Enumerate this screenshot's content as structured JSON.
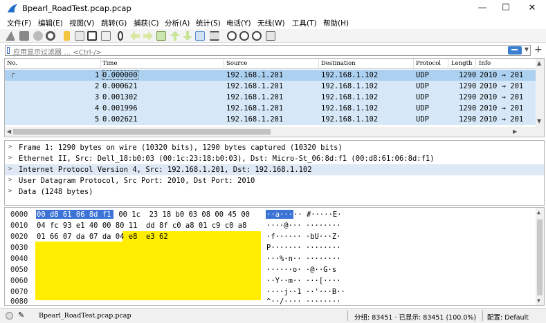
{
  "window": {
    "title": "Bpearl_RoadTest.pcap.pcap"
  },
  "menu": [
    "文件(F)",
    "编辑(E)",
    "视图(V)",
    "跳转(G)",
    "捕获(C)",
    "分析(A)",
    "统计(S)",
    "电话(Y)",
    "无线(W)",
    "工具(T)",
    "帮助(H)"
  ],
  "filter": {
    "placeholder": "应用显示过滤器 … <Ctrl-/>"
  },
  "packet_list": {
    "columns": [
      "No.",
      "Time",
      "Source",
      "Destination",
      "Protocol",
      "Length",
      "Info"
    ],
    "rows": [
      {
        "no": "1",
        "time": "0.000000",
        "source": "192.168.1.201",
        "destination": "192.168.1.102",
        "protocol": "UDP",
        "length": "1290",
        "info": "2010 → 201"
      },
      {
        "no": "2",
        "time": "0.000621",
        "source": "192.168.1.201",
        "destination": "192.168.1.102",
        "protocol": "UDP",
        "length": "1290",
        "info": "2010 → 201"
      },
      {
        "no": "3",
        "time": "0.001302",
        "source": "192.168.1.201",
        "destination": "192.168.1.102",
        "protocol": "UDP",
        "length": "1290",
        "info": "2010 → 201"
      },
      {
        "no": "4",
        "time": "0.001996",
        "source": "192.168.1.201",
        "destination": "192.168.1.102",
        "protocol": "UDP",
        "length": "1290",
        "info": "2010 → 201"
      },
      {
        "no": "5",
        "time": "0.002621",
        "source": "192.168.1.201",
        "destination": "192.168.1.102",
        "protocol": "UDP",
        "length": "1290",
        "info": "2010 → 201"
      }
    ]
  },
  "details": [
    "Frame 1: 1290 bytes on wire (10320 bits), 1290 bytes captured (10320 bits)",
    "Ethernet II, Src: Dell_18:b0:03 (00:1c:23:18:b0:03), Dst: Micro-St_06:8d:f1 (00:d8:61:06:8d:f1)",
    "Internet Protocol Version 4, Src: 192.168.1.201, Dst: 192.168.1.102",
    "User Datagram Protocol, Src Port: 2010, Dst Port: 2010",
    "Data (1248 bytes)"
  ],
  "bytes": [
    {
      "offset": "0000",
      "hex_sel": "00 d8 61 06 8d f1",
      "hex_rest": " 00 1c  23 18 b0 03 08 00 45 00",
      "ascii_sel": "··a···",
      "ascii_rest": "·· #·····E·"
    },
    {
      "offset": "0010",
      "hex": "04 fc 93 e1 40 00 80 11  dd 8f c0 a8 01 c9 c0 a8",
      "ascii": "····@··· ········"
    },
    {
      "offset": "0020",
      "hex": "01 66 07 da 07 da 04 e8  e3 62",
      "ascii": "·f······ ·bU···Z·"
    },
    {
      "offset": "0030",
      "hex": "",
      "ascii": "P······· ········"
    },
    {
      "offset": "0040",
      "hex": "",
      "ascii": "···%·n·· ········"
    },
    {
      "offset": "0050",
      "hex": "",
      "ascii": "······o· ·@··G·s"
    },
    {
      "offset": "0060",
      "hex": "",
      "ascii": "··Y··m·· ···[····"
    },
    {
      "offset": "0070",
      "hex": "",
      "ascii": "····j··1 ··'···B··"
    },
    {
      "offset": "0080",
      "hex": "",
      "ascii": "^··/···· ········"
    }
  ],
  "status": {
    "file": "Bpearl_RoadTest.pcap.pcap",
    "stats": "分组: 83451 · 已显示: 83451 (100.0%)",
    "profile": "配置: Default"
  }
}
